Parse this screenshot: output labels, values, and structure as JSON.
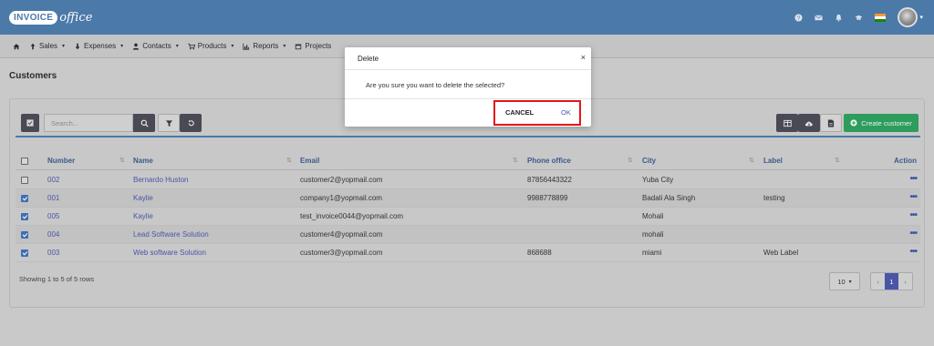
{
  "brand": {
    "logo_box": "INVOICE",
    "logo_script": "office"
  },
  "nav": {
    "items": [
      {
        "label": "Sales"
      },
      {
        "label": "Expenses"
      },
      {
        "label": "Contacts"
      },
      {
        "label": "Products"
      },
      {
        "label": "Reports"
      },
      {
        "label": "Projects"
      }
    ]
  },
  "page": {
    "title": "Customers"
  },
  "toolbar": {
    "search_placeholder": "Search...",
    "create_label": "Create customer"
  },
  "table": {
    "headers": {
      "number": "Number",
      "name": "Name",
      "email": "Email",
      "phone": "Phone office",
      "city": "City",
      "label": "Label",
      "action": "Action"
    },
    "rows": [
      {
        "number": "002",
        "name": "Bernardo Huston",
        "email": "customer2@yopmail.com",
        "phone": "87856443322",
        "city": "Yuba City",
        "label": "",
        "checked": false
      },
      {
        "number": "001",
        "name": "Kaylie",
        "email": "company1@yopmail.com",
        "phone": "9988778899",
        "city": "Badali Ala Singh",
        "label": "testing",
        "checked": true
      },
      {
        "number": "005",
        "name": "Kaylie",
        "email": "test_invoice0044@yopmail.com",
        "phone": "",
        "city": "Mohali",
        "label": "",
        "checked": true
      },
      {
        "number": "004",
        "name": "Lead Software Solution",
        "email": "customer4@yopmail.com",
        "phone": "",
        "city": "mohali",
        "label": "",
        "checked": true
      },
      {
        "number": "003",
        "name": "Web software Solution",
        "email": "customer3@yopmail.com",
        "phone": "868688",
        "city": "miami",
        "label": "Web Label",
        "checked": true
      }
    ],
    "action_glyph": "•••"
  },
  "footer": {
    "showing": "Showing 1 to 5 of 5 rows",
    "page_size": "10",
    "current_page": "1",
    "prev": "‹",
    "next": "›"
  },
  "modal": {
    "title": "Delete",
    "close": "×",
    "message": "Are you sure you want to delete the selected?",
    "cancel_label": "CANCEL",
    "ok_label": "OK"
  },
  "colors": {
    "topbar": "#4b79a8",
    "accent": "#4a55a8",
    "create": "#2e9c5c",
    "highlight": "#e3151a"
  }
}
